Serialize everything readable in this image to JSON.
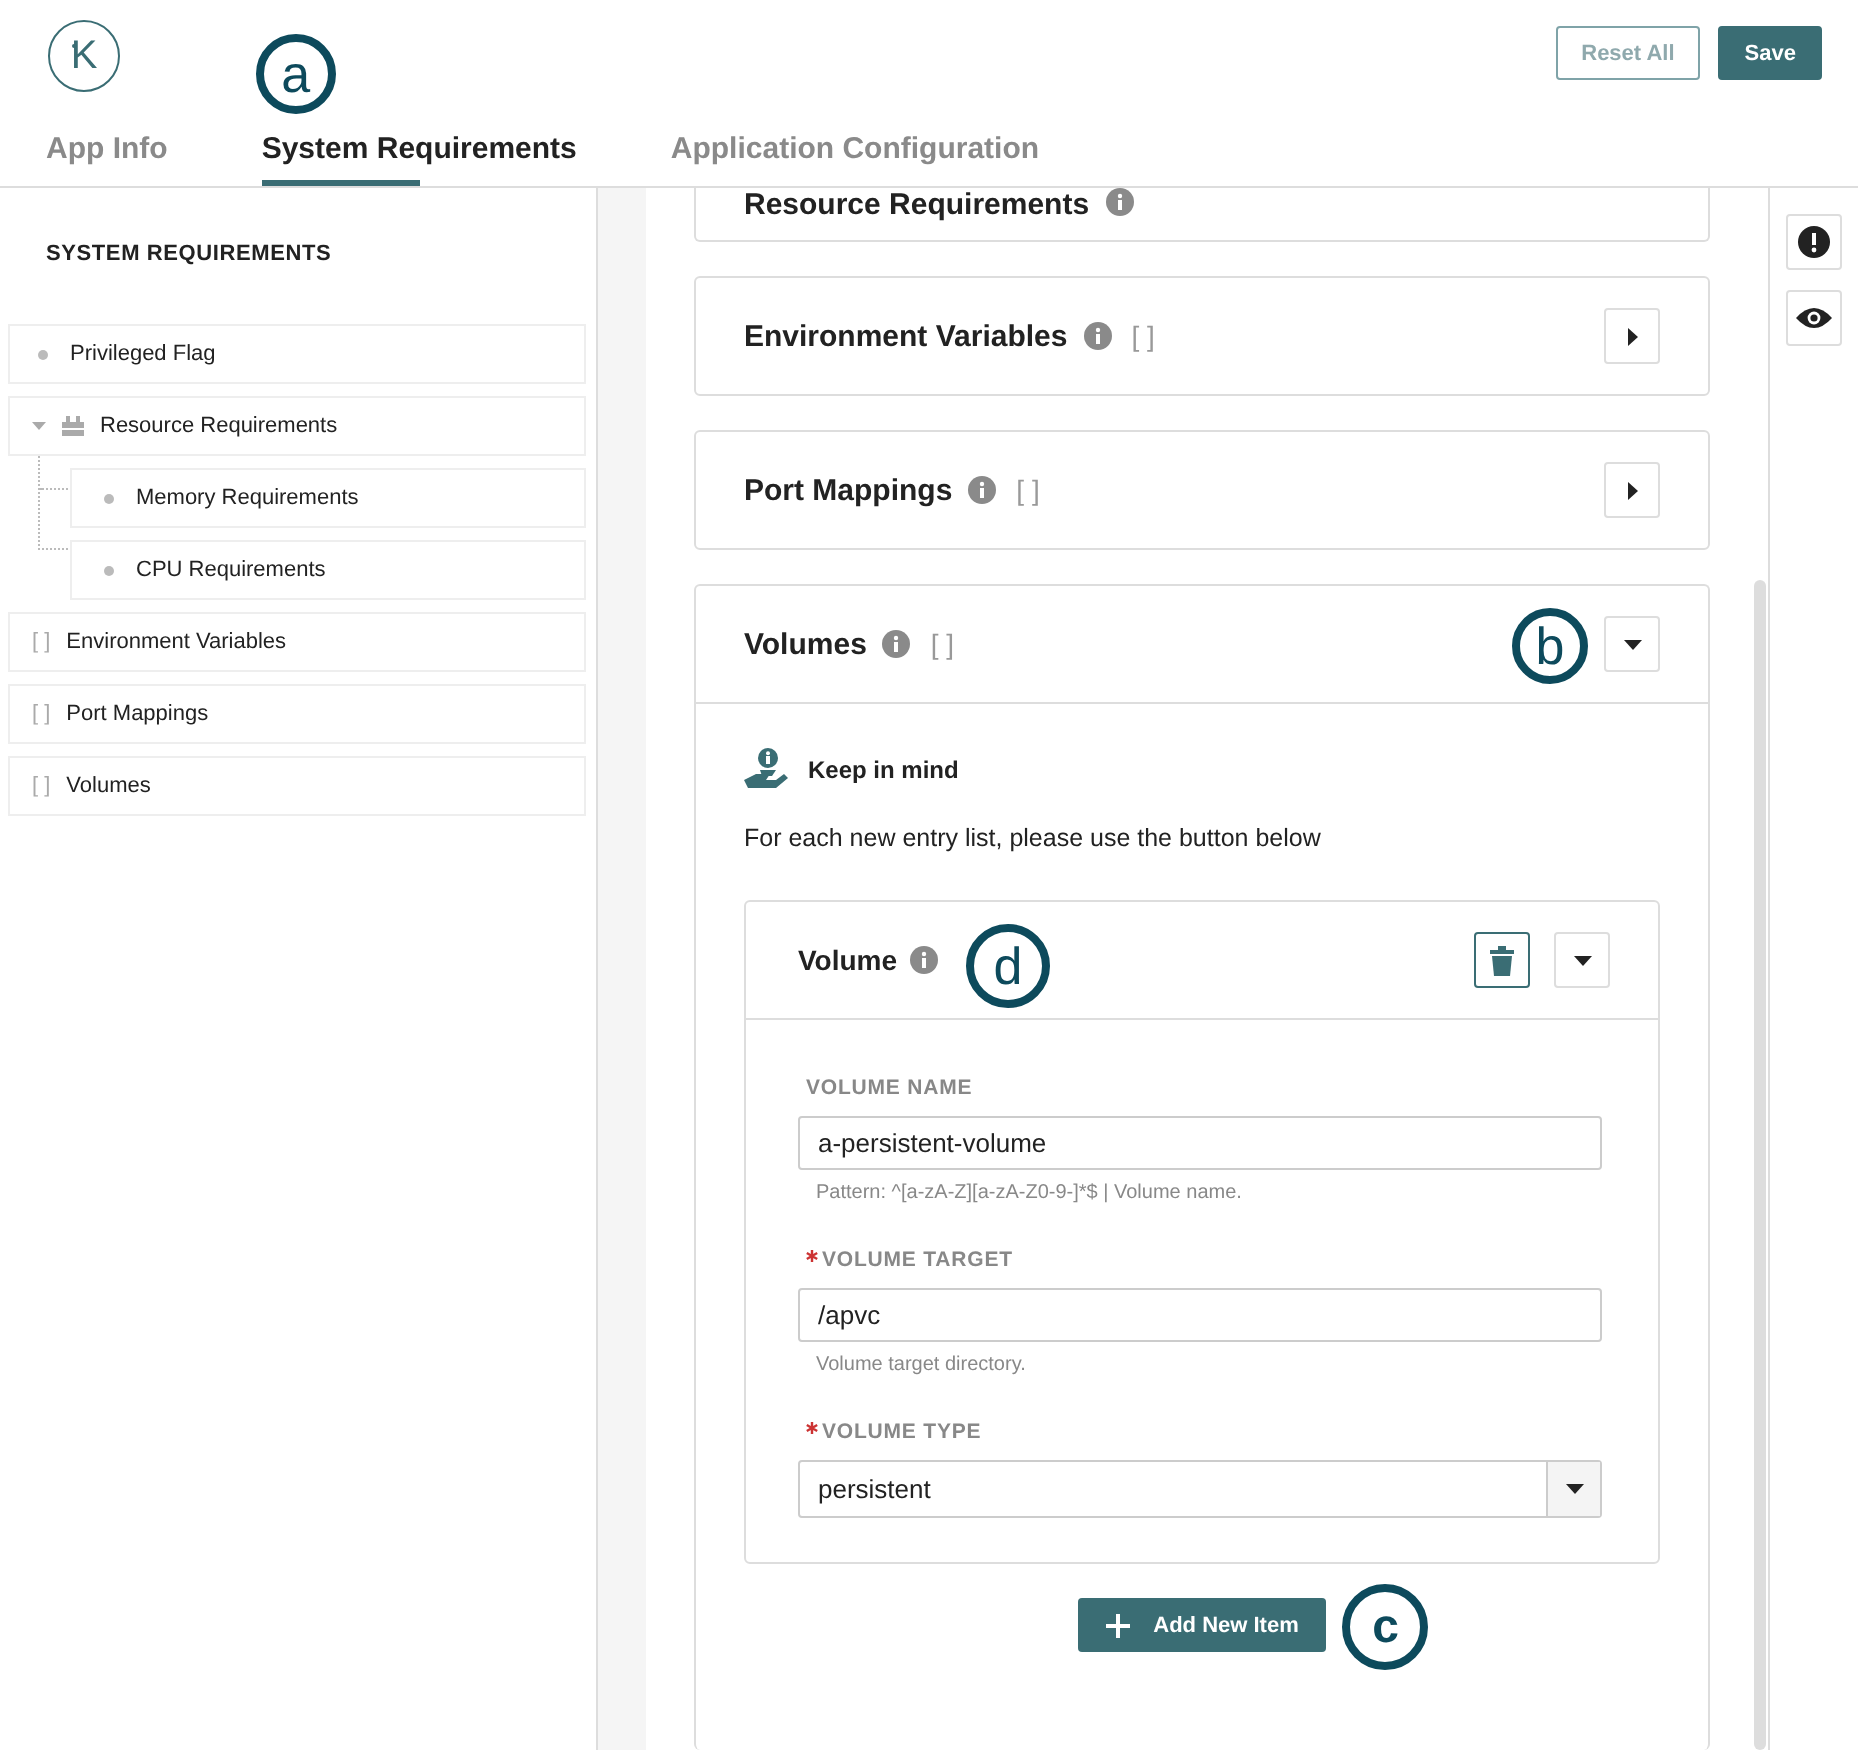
{
  "logo": {
    "letter": "K"
  },
  "header_buttons": [
    {
      "label": "Reset All",
      "kind": "secondary"
    },
    {
      "label": "Save",
      "kind": "primary"
    }
  ],
  "tabs": [
    {
      "label": "App Info",
      "selected": false
    },
    {
      "label": "System Requirements",
      "selected": true,
      "callout": "a"
    },
    {
      "label": "Application Configuration",
      "selected": false
    }
  ],
  "sidebar": {
    "title": "SYSTEM REQUIREMENTS",
    "items": [
      {
        "label": "Privileged Flag",
        "kind": "field"
      },
      {
        "label": "Resource Requirements",
        "kind": "group",
        "expanded": true,
        "children": [
          {
            "label": "Memory Requirements",
            "kind": "field"
          },
          {
            "label": "CPU Requirements",
            "kind": "field"
          }
        ]
      },
      {
        "label": "Environment Variables",
        "kind": "list",
        "marker": "[ ]"
      },
      {
        "label": "Port Mappings",
        "kind": "list",
        "marker": "[ ]"
      },
      {
        "label": "Volumes",
        "kind": "list",
        "marker": "[ ]"
      }
    ]
  },
  "sections": [
    {
      "title": "Resource Requirements",
      "kind": "partial"
    },
    {
      "title": "Environment Variables",
      "kind": "panel",
      "marker": "[ ]",
      "expanded": false
    },
    {
      "title": "Port Mappings",
      "kind": "panel",
      "marker": "[ ]",
      "expanded": false
    },
    {
      "title": "Volumes",
      "kind": "panel",
      "marker": "[ ]",
      "expanded": true,
      "callout": "b",
      "panel": {
        "note_title": "Keep in mind",
        "note_text": "For each new entry list, please use the button below",
        "item": {
          "title": "Volume",
          "callout": "d",
          "expanded": true,
          "fields": [
            {
              "label": "VOLUME NAME",
              "required": false,
              "kind": "text",
              "value": "a-persistent-volume",
              "help": "Pattern: ^[a-zA-Z][a-zA-Z0-9-]*$ | Volume name."
            },
            {
              "label": "VOLUME TARGET",
              "required": true,
              "kind": "text",
              "value": "/apvc",
              "help": "Volume target directory."
            },
            {
              "label": "VOLUME TYPE",
              "required": true,
              "kind": "select",
              "value": "persistent"
            }
          ]
        },
        "add_button": {
          "label": "Add New Item",
          "callout": "c"
        }
      }
    }
  ]
}
